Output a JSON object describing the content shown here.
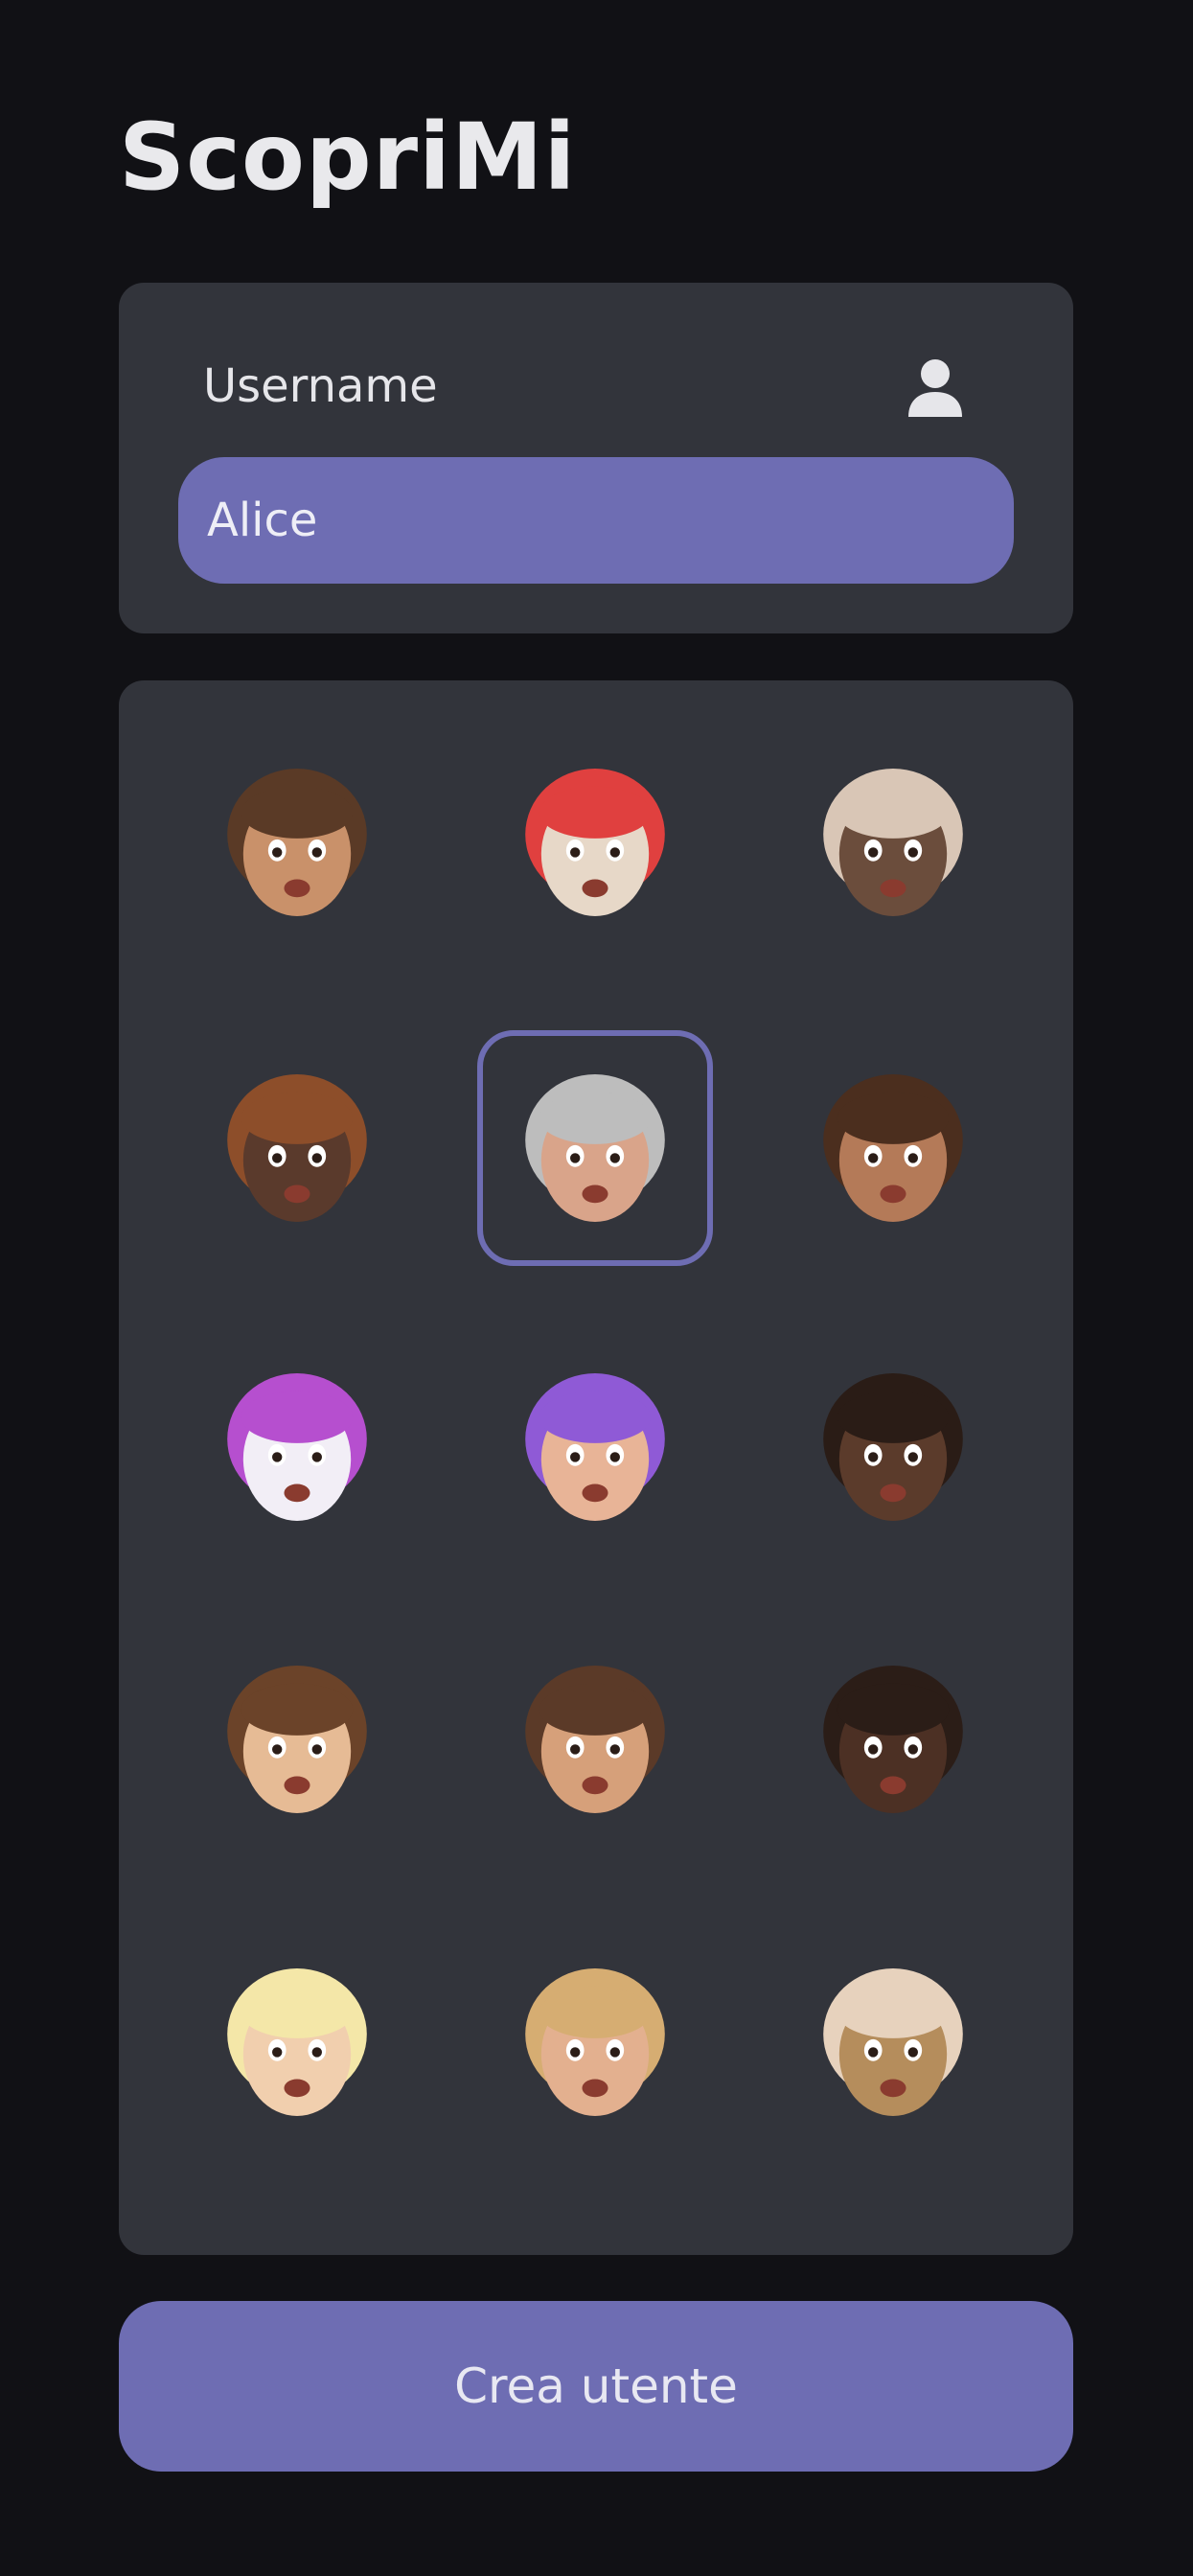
{
  "app": {
    "title": "ScopriMi"
  },
  "username": {
    "label": "Username",
    "value": "Alice",
    "icon": "person-icon"
  },
  "avatars": {
    "selected_index": 4,
    "items": [
      {
        "name": "avatar-boy-surprised",
        "skin": "#c9916a",
        "hair": "#5a3a26"
      },
      {
        "name": "avatar-rooster",
        "skin": "#e7d8c8",
        "hair": "#e0403f"
      },
      {
        "name": "avatar-boar-mind-blown",
        "skin": "#6b4d3c",
        "hair": "#d9c6b6"
      },
      {
        "name": "avatar-curly-hair-woman",
        "skin": "#5a3a2c",
        "hair": "#8d4e2a"
      },
      {
        "name": "avatar-silver-hair-sunglasses",
        "skin": "#d9a48a",
        "hair": "#bdbdbd"
      },
      {
        "name": "avatar-afro-glasses-man",
        "skin": "#b47a58",
        "hair": "#4b2e1e"
      },
      {
        "name": "avatar-unicorn-crying",
        "skin": "#f2eef6",
        "hair": "#b64fcf"
      },
      {
        "name": "avatar-purple-hair-wink",
        "skin": "#e8b497",
        "hair": "#8f5ad6"
      },
      {
        "name": "avatar-bantu-knots-man",
        "skin": "#5b3b2b",
        "hair": "#2a1c16"
      },
      {
        "name": "avatar-sleeping-beanie",
        "skin": "#e6bb95",
        "hair": "#6b4329"
      },
      {
        "name": "avatar-peace-sign-woman",
        "skin": "#d6a07a",
        "hair": "#5b3a28"
      },
      {
        "name": "avatar-bald-beard-man",
        "skin": "#4c3024",
        "hair": "#2b1d17"
      },
      {
        "name": "avatar-clouds-sunglasses",
        "skin": "#f1cfae",
        "hair": "#f4e7a8"
      },
      {
        "name": "avatar-blonde-woman",
        "skin": "#e3b08f",
        "hair": "#d6ad72"
      },
      {
        "name": "avatar-monkey-mind-blown",
        "skin": "#b58d5c",
        "hair": "#e7d2bd"
      }
    ]
  },
  "actions": {
    "create_label": "Crea utente"
  }
}
